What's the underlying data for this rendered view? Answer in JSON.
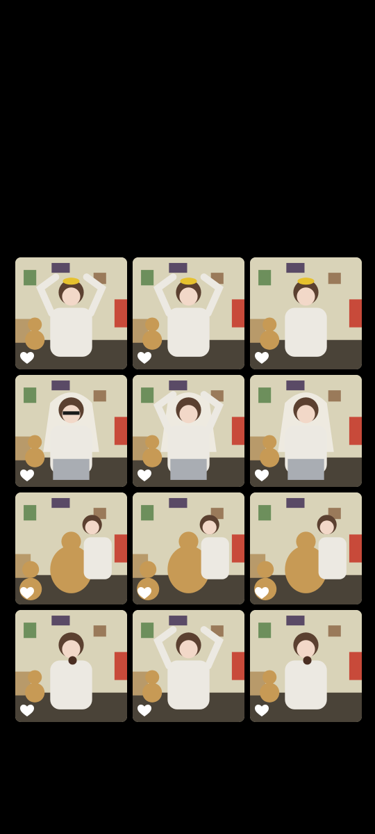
{
  "gallery": {
    "items": [
      {
        "scene": "arms-raised-headband",
        "liked": false
      },
      {
        "scene": "arms-raised-headband",
        "liked": false
      },
      {
        "scene": "hands-on-cheeks",
        "liked": false
      },
      {
        "scene": "veil-sunglasses",
        "liked": false
      },
      {
        "scene": "veil-arms-up",
        "liked": false
      },
      {
        "scene": "veil-standing",
        "liked": false
      },
      {
        "scene": "teddy-bear-hug",
        "liked": false
      },
      {
        "scene": "teddy-bear-hug",
        "liked": false
      },
      {
        "scene": "teddy-bear-hug",
        "liked": false
      },
      {
        "scene": "holding-treat",
        "liked": false
      },
      {
        "scene": "hands-on-head",
        "liked": false
      },
      {
        "scene": "eating-treat",
        "liked": false
      }
    ],
    "heart_icon": "heart-outline-icon",
    "colors": {
      "background": "#000000",
      "heart": "#ffffff",
      "wall": "#d9d3b8",
      "floor": "#4a4338",
      "sweater": "#ece9e2",
      "hair": "#5b4030",
      "bear": "#c79a55"
    }
  }
}
